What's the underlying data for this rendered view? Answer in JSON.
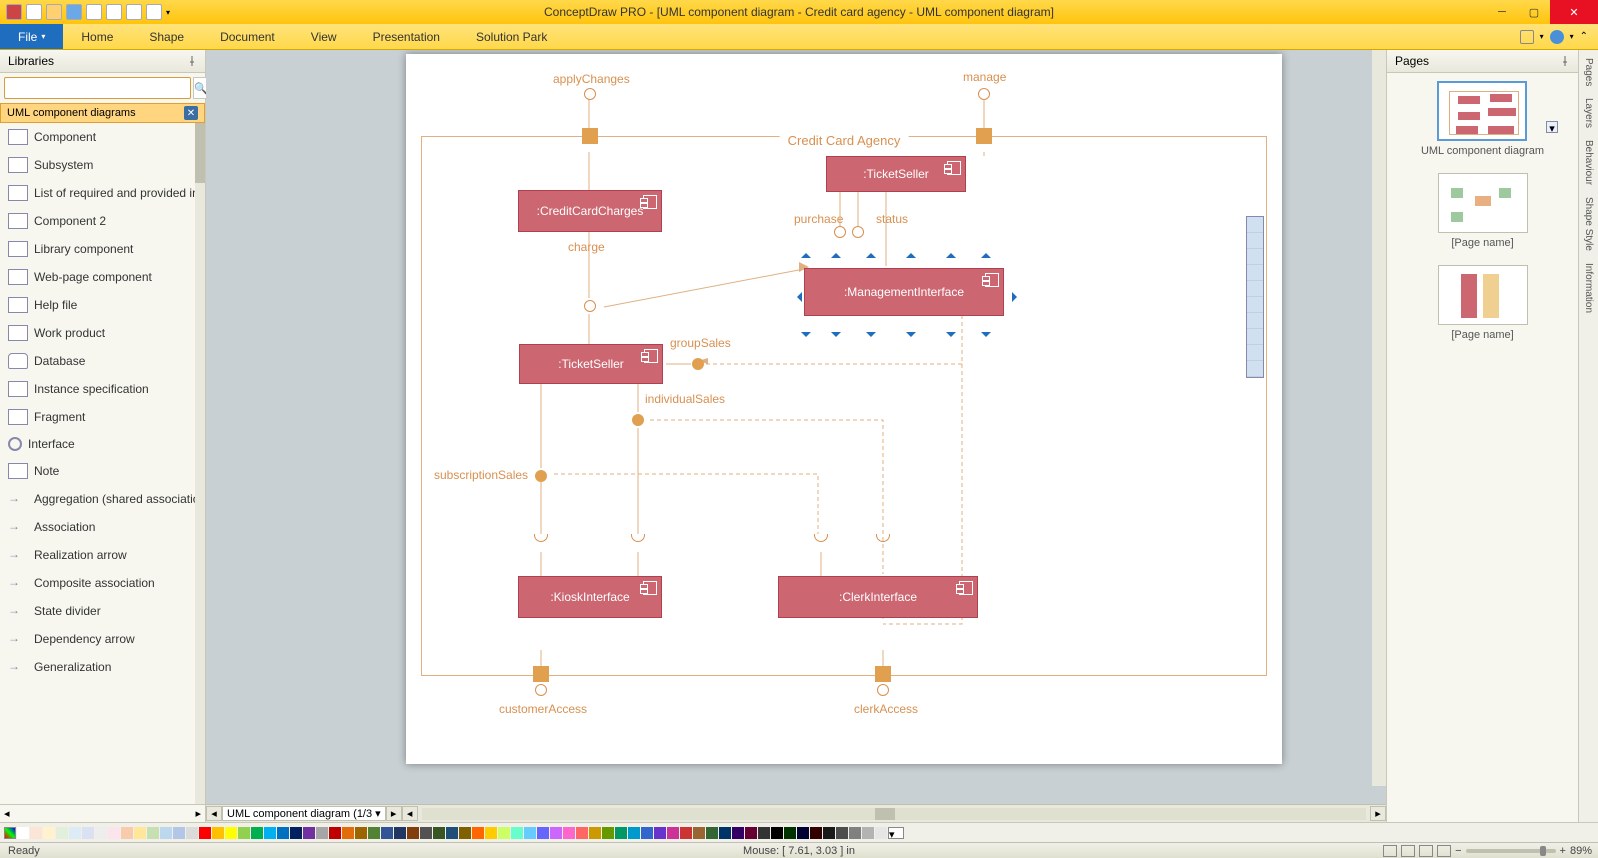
{
  "app_title": "ConceptDraw PRO - [UML component diagram - Credit card agency - UML component diagram]",
  "ribbon": {
    "file": "File",
    "tabs": [
      "Home",
      "Shape",
      "Document",
      "View",
      "Presentation",
      "Solution Park"
    ]
  },
  "libraries": {
    "title": "Libraries",
    "search_placeholder": "",
    "current_lib": "UML component diagrams",
    "items": [
      "Component",
      "Subsystem",
      "List of required and provided in",
      "Component 2",
      "Library component",
      "Web-page component",
      "Help file",
      "Work product",
      "Database",
      "Instance specification",
      "Fragment",
      "Interface",
      "Note",
      "Aggregation (shared associatio",
      "Association",
      "Realization arrow",
      "Composite association",
      "State divider",
      "Dependency arrow",
      "Generalization"
    ]
  },
  "diagram": {
    "frame_title": "Credit Card Agency",
    "labels": {
      "applyChanges": "applyChanges",
      "manage": "manage",
      "purchase": "purchase",
      "status": "status",
      "charge": "charge",
      "groupSales": "groupSales",
      "individualSales": "individualSales",
      "subscriptionSales": "subscriptionSales",
      "customerAccess": "customerAccess",
      "clerkAccess": "clerkAccess"
    },
    "components": {
      "cc": ":CreditCardCharges",
      "ts1": ":TicketSeller",
      "mi": ":ManagementInterface",
      "ts2": ":TicketSeller",
      "ki": ":KioskInterface",
      "ci": ":ClerkInterface"
    }
  },
  "pages": {
    "title": "Pages",
    "thumbs": [
      "UML component diagram",
      "[Page name]",
      "[Page name]"
    ]
  },
  "vtabs": [
    "Pages",
    "Layers",
    "Behaviour",
    "Shape Style",
    "Information"
  ],
  "canvas_tab": "UML component diagram (1/3",
  "status": {
    "ready": "Ready",
    "mouse": "Mouse: [ 7.61, 3.03 ] in",
    "zoom": "89%"
  },
  "palette": [
    "#ffffff",
    "#fce4d6",
    "#fff2cc",
    "#e2efda",
    "#ddebf7",
    "#d9e1f2",
    "#ededed",
    "#fce4ec",
    "#f8cbad",
    "#ffe699",
    "#c6e0b4",
    "#bdd7ee",
    "#b4c6e7",
    "#dbdbdb",
    "#ff0000",
    "#ffc000",
    "#ffff00",
    "#92d050",
    "#00b050",
    "#00b0f0",
    "#0070c0",
    "#002060",
    "#7030a0",
    "#a6a6a6",
    "#c00000",
    "#e26b0a",
    "#9c6500",
    "#548235",
    "#305496",
    "#203764",
    "#833c0c",
    "#525252",
    "#375623",
    "#1f4e78",
    "#806000",
    "#ff6600",
    "#ffcc00",
    "#ccff66",
    "#66ffcc",
    "#66ccff",
    "#6666ff",
    "#cc66ff",
    "#ff66cc",
    "#ff6666",
    "#cc9900",
    "#669900",
    "#009966",
    "#0099cc",
    "#3366cc",
    "#6633cc",
    "#cc3399",
    "#cc3333",
    "#996633",
    "#336633",
    "#003366",
    "#330066",
    "#660033",
    "#333333",
    "#000000",
    "#003300",
    "#000033",
    "#330000",
    "#1a1a1a",
    "#4d4d4d",
    "#808080",
    "#b3b3b3",
    "#e6e6e6"
  ],
  "chart_data": {
    "type": "uml-component-diagram",
    "title": "Credit Card Agency",
    "components": [
      {
        "id": "cc",
        "name": ":CreditCardCharges"
      },
      {
        "id": "ts_top",
        "name": ":TicketSeller"
      },
      {
        "id": "mi",
        "name": ":ManagementInterface",
        "selected": true
      },
      {
        "id": "ts_mid",
        "name": ":TicketSeller"
      },
      {
        "id": "ki",
        "name": ":KioskInterface"
      },
      {
        "id": "ci",
        "name": ":ClerkInterface"
      }
    ],
    "frame_ports": [
      {
        "side": "top",
        "label": "applyChanges",
        "kind": "required"
      },
      {
        "side": "top",
        "label": "manage",
        "kind": "required"
      },
      {
        "side": "bottom",
        "label": "customerAccess",
        "kind": "required"
      },
      {
        "side": "bottom",
        "label": "clerkAccess",
        "kind": "required"
      }
    ],
    "interfaces": [
      {
        "name": "charge",
        "provided_by": "cc",
        "required_by": "ts_mid"
      },
      {
        "name": "purchase",
        "provided_by": "ts_top",
        "required_by": "mi"
      },
      {
        "name": "status",
        "provided_by": "ts_top",
        "required_by": "mi"
      },
      {
        "name": "groupSales",
        "provided_by": "ts_mid",
        "required_by": [
          "mi",
          "ci"
        ]
      },
      {
        "name": "individualSales",
        "provided_by": "ts_mid",
        "required_by": [
          "ki",
          "ci"
        ]
      },
      {
        "name": "subscriptionSales",
        "provided_by": "ts_mid",
        "required_by": [
          "ki",
          "ci"
        ]
      }
    ],
    "delegations": [
      {
        "port": "applyChanges",
        "to": "cc"
      },
      {
        "port": "manage",
        "to": "ts_top"
      },
      {
        "port": "customerAccess",
        "to": "ki"
      },
      {
        "port": "clerkAccess",
        "to": "ci"
      }
    ]
  }
}
